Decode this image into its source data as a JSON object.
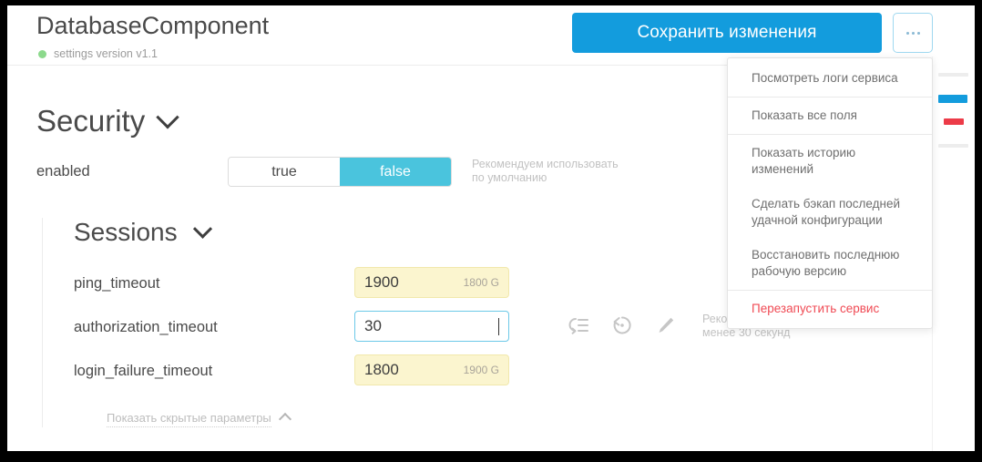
{
  "header": {
    "title": "DatabaseComponent",
    "subtitle": "settings version v1.1",
    "status_dot_color": "#8cd98c",
    "save_label": "Сохранить изменения",
    "save_color": "#139cdd",
    "kebab_label": "..."
  },
  "menu": {
    "items": [
      {
        "label": "Посмотреть логи сервиса",
        "danger": false
      },
      {
        "label": "Показать все поля",
        "danger": false
      },
      {
        "label": "Показать историю\nизменений",
        "danger": false
      },
      {
        "label": "Сделать бэкап последней\nудачной конфигурации",
        "danger": false
      },
      {
        "label": "Восстановить последнюю\nрабочую версию",
        "danger": false
      },
      {
        "label": "Перезапустить сервис",
        "danger": true
      }
    ],
    "danger_color": "#f04a54"
  },
  "security": {
    "title": "Security",
    "enabled_label": "enabled",
    "toggle": {
      "options": [
        "true",
        "false"
      ],
      "selected": "false",
      "active_color": "#4ac4dd"
    },
    "hint": "Рекомендуем использовать\nпо умолчанию"
  },
  "sessions": {
    "title": "Sessions",
    "fields": [
      {
        "label": "ping_timeout",
        "value": "1900",
        "suffix": "1800 G",
        "state": "modified"
      },
      {
        "label": "authorization_timeout",
        "value": "30",
        "suffix": "",
        "state": "active",
        "hint": "Рекомендуем использовать не\nменее 30 секунд"
      },
      {
        "label": "login_failure_timeout",
        "value": "1800",
        "suffix": "1900 G",
        "state": "modified"
      }
    ],
    "row_icons": [
      "apply-to-all-icon",
      "revert-icon",
      "edit-icon"
    ],
    "show_hidden_label": "Показать скрытые параметры"
  },
  "minimap": {
    "blue_color": "#139cdd",
    "red_color": "#ec3b48"
  }
}
